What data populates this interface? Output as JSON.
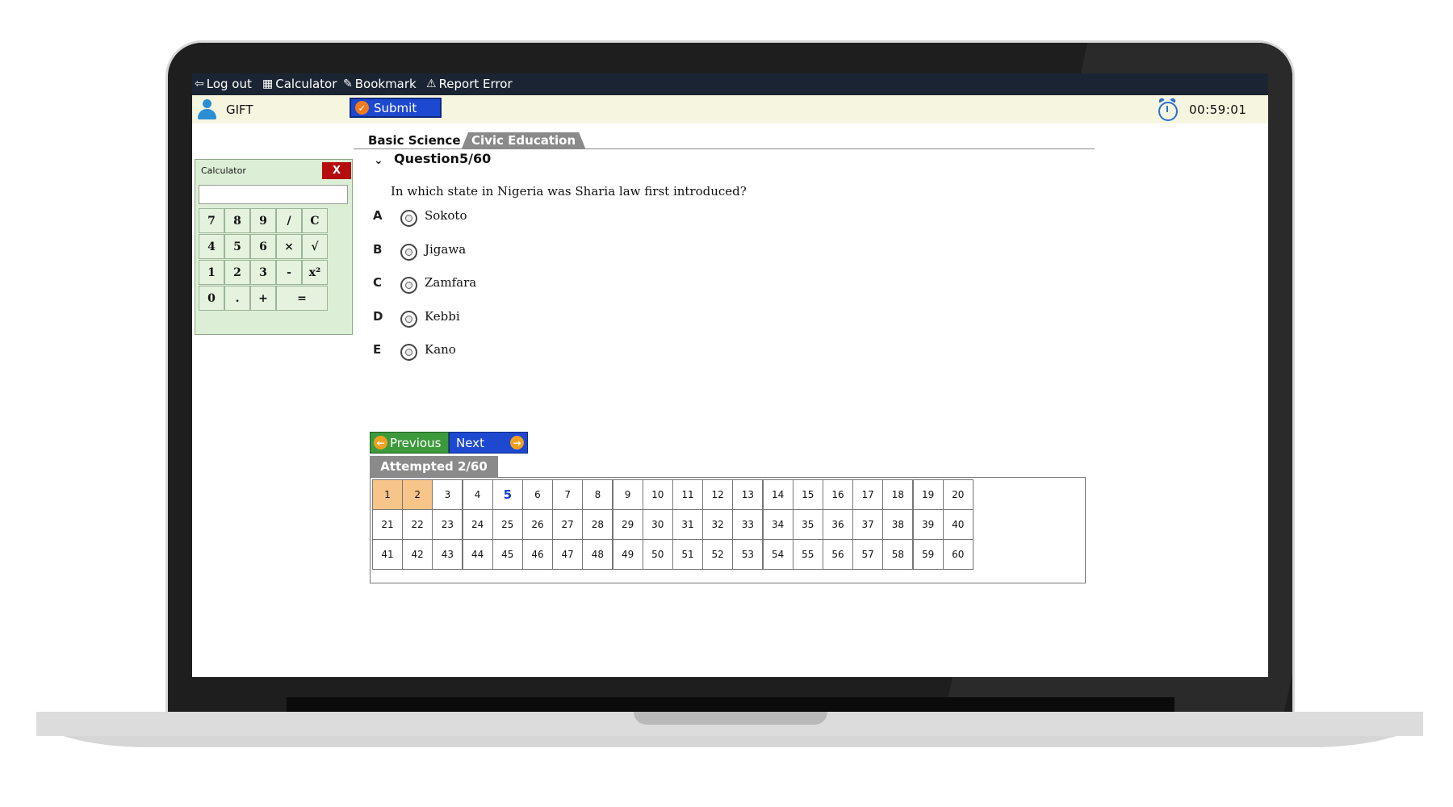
{
  "menu": {
    "logout": "Log out",
    "calculator": "Calculator",
    "bookmark": "Bookmark",
    "report_error": "Report Error"
  },
  "header": {
    "user_name": "GIFT",
    "submit_label": "Submit",
    "timer": "00:59:01"
  },
  "tabs": [
    "Basic Science",
    "Civic Education"
  ],
  "active_tab": "Civic Education",
  "calculator": {
    "title": "Calculator",
    "close_label": "X",
    "display_value": "",
    "keys": [
      "7",
      "8",
      "9",
      "/",
      "C",
      "4",
      "5",
      "6",
      "×",
      "√",
      "1",
      "2",
      "3",
      "-",
      "x²",
      "0",
      ".",
      "+",
      "="
    ]
  },
  "question": {
    "label": "Question",
    "number": "5/60",
    "text": "In which state in Nigeria was Sharia law first introduced?",
    "options": [
      {
        "letter": "A",
        "text": "Sokoto"
      },
      {
        "letter": "B",
        "text": "Jigawa"
      },
      {
        "letter": "C",
        "text": "Zamfara"
      },
      {
        "letter": "D",
        "text": "Kebbi"
      },
      {
        "letter": "E",
        "text": "Kano"
      }
    ]
  },
  "nav": {
    "previous": "Previous",
    "next": "Next",
    "attempted": "Attempted 2/60"
  },
  "grid": {
    "total": 60,
    "answered": [
      1,
      2
    ],
    "current": 5
  },
  "colors": {
    "menubar": "#1b2432",
    "header": "#f6f5e0",
    "submit": "#1d49d1",
    "previous": "#3c9a3c",
    "answered": "#f7c48a",
    "calc_bg": "#ddeed6",
    "calc_close": "#b50d0d"
  },
  "icons": {
    "logout": "logout-icon",
    "calculator": "calculator-icon",
    "bookmark": "bookmark-icon",
    "report_error": "warning-icon",
    "user": "user-icon",
    "submit": "check-icon",
    "timer": "alarm-clock-icon",
    "previous": "arrow-left-icon",
    "next": "arrow-right-icon"
  }
}
